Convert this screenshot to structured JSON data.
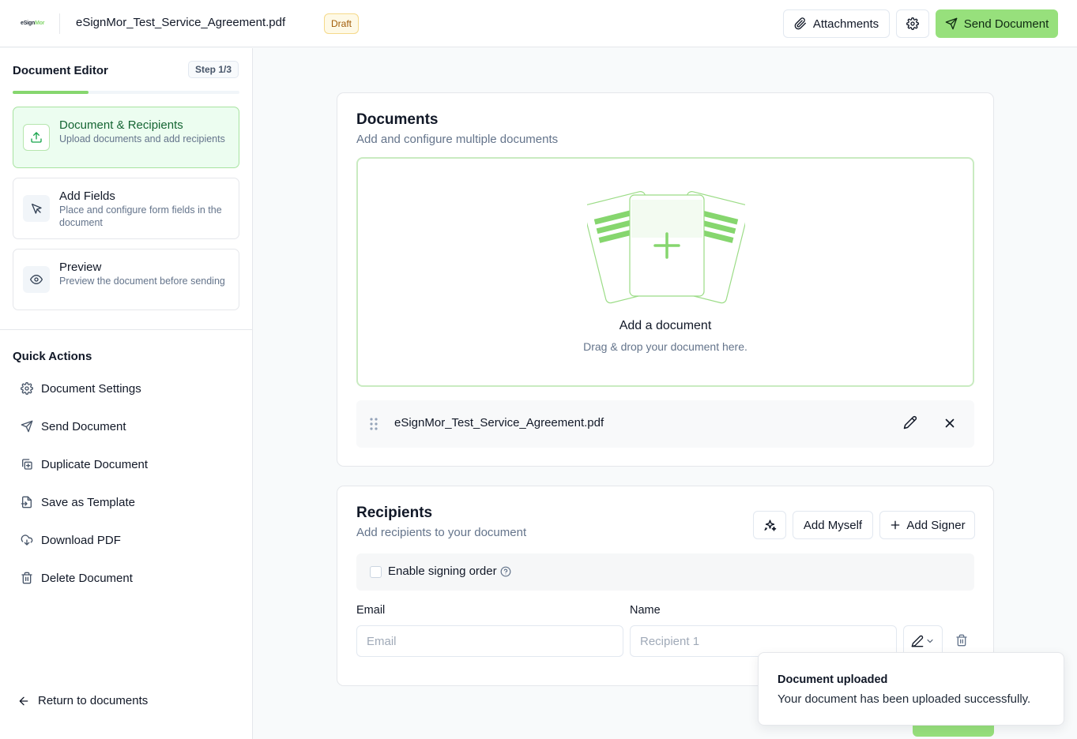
{
  "header": {
    "logo_text_dark": "eSign",
    "logo_text_accent": "Mor",
    "document_title": "eSignMor_Test_Service_Agreement.pdf",
    "status_badge": "Draft",
    "attachments_label": "Attachments",
    "send_label": "Send Document",
    "accent_color": "#97e07c"
  },
  "sidebar": {
    "title": "Document Editor",
    "step_badge": "Step 1/3",
    "progress_fraction": 0.333,
    "steps": [
      {
        "title": "Document & Recipients",
        "description": "Upload documents and add recipients",
        "icon": "upload-icon",
        "active": true
      },
      {
        "title": "Add Fields",
        "description": "Place and configure form fields in the document",
        "icon": "cursor-icon",
        "active": false
      },
      {
        "title": "Preview",
        "description": "Preview the document before sending",
        "icon": "eye-icon",
        "active": false
      }
    ],
    "quick_actions_title": "Quick Actions",
    "quick_actions": [
      {
        "label": "Document Settings",
        "icon": "gear-icon"
      },
      {
        "label": "Send Document",
        "icon": "send-icon"
      },
      {
        "label": "Duplicate Document",
        "icon": "duplicate-icon"
      },
      {
        "label": "Save as Template",
        "icon": "template-icon"
      },
      {
        "label": "Download PDF",
        "icon": "download-cloud-icon"
      },
      {
        "label": "Delete Document",
        "icon": "trash-icon"
      }
    ],
    "return_label": "Return to documents"
  },
  "documents": {
    "title": "Documents",
    "subtitle": "Add and configure multiple documents",
    "dropzone_title": "Add a document",
    "dropzone_subtitle": "Drag & drop your document here.",
    "files": [
      {
        "name": "eSignMor_Test_Service_Agreement.pdf"
      }
    ]
  },
  "recipients": {
    "title": "Recipients",
    "subtitle": "Add recipients to your document",
    "add_myself_label": "Add Myself",
    "add_signer_label": "Add Signer",
    "signing_order_label": "Enable signing order",
    "email_label": "Email",
    "name_label": "Name",
    "email_placeholder": "Email",
    "name_placeholder": "Recipient 1"
  },
  "toast": {
    "title": "Document uploaded",
    "message": "Your document has been uploaded successfully."
  }
}
